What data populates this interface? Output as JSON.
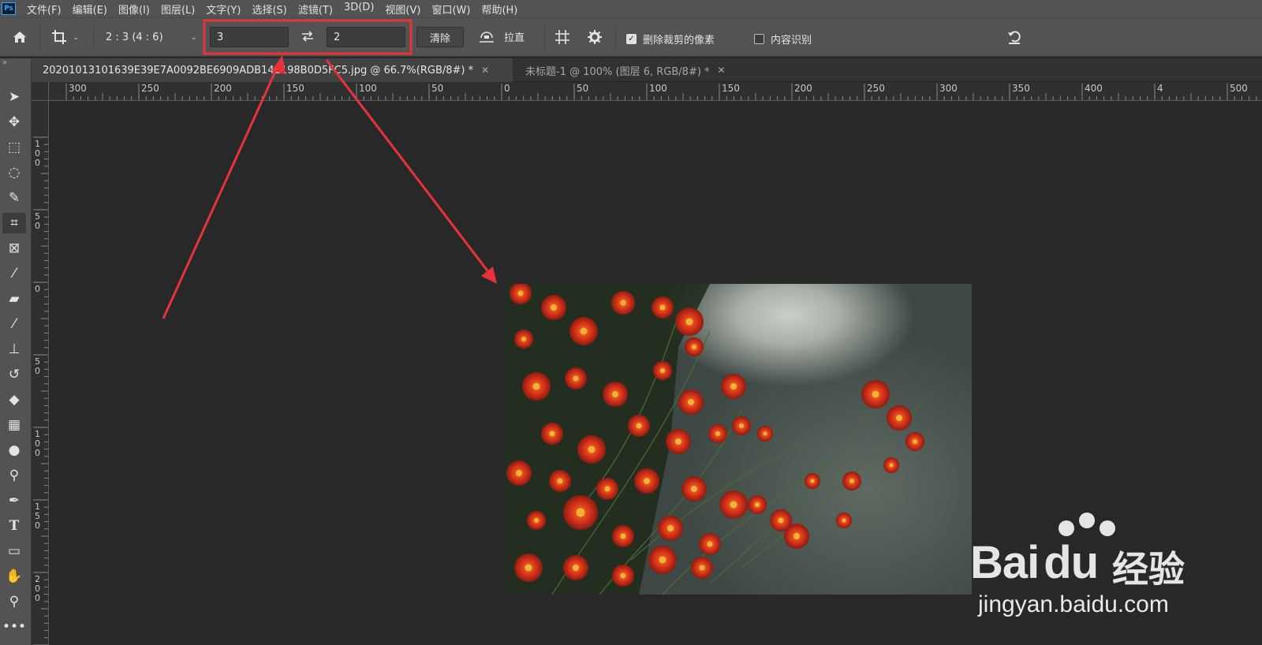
{
  "app": {
    "logo": "Ps"
  },
  "menu": [
    "文件(F)",
    "编辑(E)",
    "图像(I)",
    "图层(L)",
    "文字(Y)",
    "选择(S)",
    "滤镜(T)",
    "3D(D)",
    "视图(V)",
    "窗口(W)",
    "帮助(H)"
  ],
  "options": {
    "ratio_preset": "2 : 3 (4 : 6)",
    "width_value": "3",
    "height_value": "2",
    "clear_label": "清除",
    "straighten_label": "拉直",
    "delete_cropped_label": "删除裁剪的像素",
    "delete_cropped_checked": true,
    "content_aware_label": "内容识别",
    "content_aware_checked": false
  },
  "tabs": [
    {
      "title": "20201013101639E39E7A0092BE6909ADB142198B0D5FC5.jpg @ 66.7%(RGB/8#) *",
      "active": true
    },
    {
      "title": "未标题-1 @ 100% (图层 6, RGB/8#) *",
      "active": false
    }
  ],
  "ruler_top": [
    "300",
    "250",
    "200",
    "150",
    "100",
    "50",
    "0",
    "50",
    "100",
    "150",
    "200",
    "250",
    "300",
    "350",
    "400",
    "4",
    "500"
  ],
  "ruler_left": [
    "100",
    "50",
    "0",
    "50",
    "100",
    "150",
    "200"
  ],
  "tools": [
    "move-tool-icon",
    "artboard-move-icon",
    "marquee-icon",
    "lasso-icon",
    "quick-select-icon",
    "crop-icon",
    "frame-icon",
    "eyedropper-icon",
    "healing-brush-icon",
    "brush-icon",
    "stamp-icon",
    "history-brush-icon",
    "eraser-icon",
    "gradient-icon",
    "blur-icon",
    "dodge-icon",
    "pen-icon",
    "type-icon",
    "rectangle-icon",
    "hand-icon",
    "zoom-icon",
    "more-tools-icon"
  ],
  "watermark": {
    "brand": "Bai",
    "brand2": "du",
    "cn": "经验",
    "url": "jingyan.baidu.com"
  },
  "colors": {
    "annotation": "#e8323a",
    "panel": "#535353",
    "canvas": "#282828"
  }
}
